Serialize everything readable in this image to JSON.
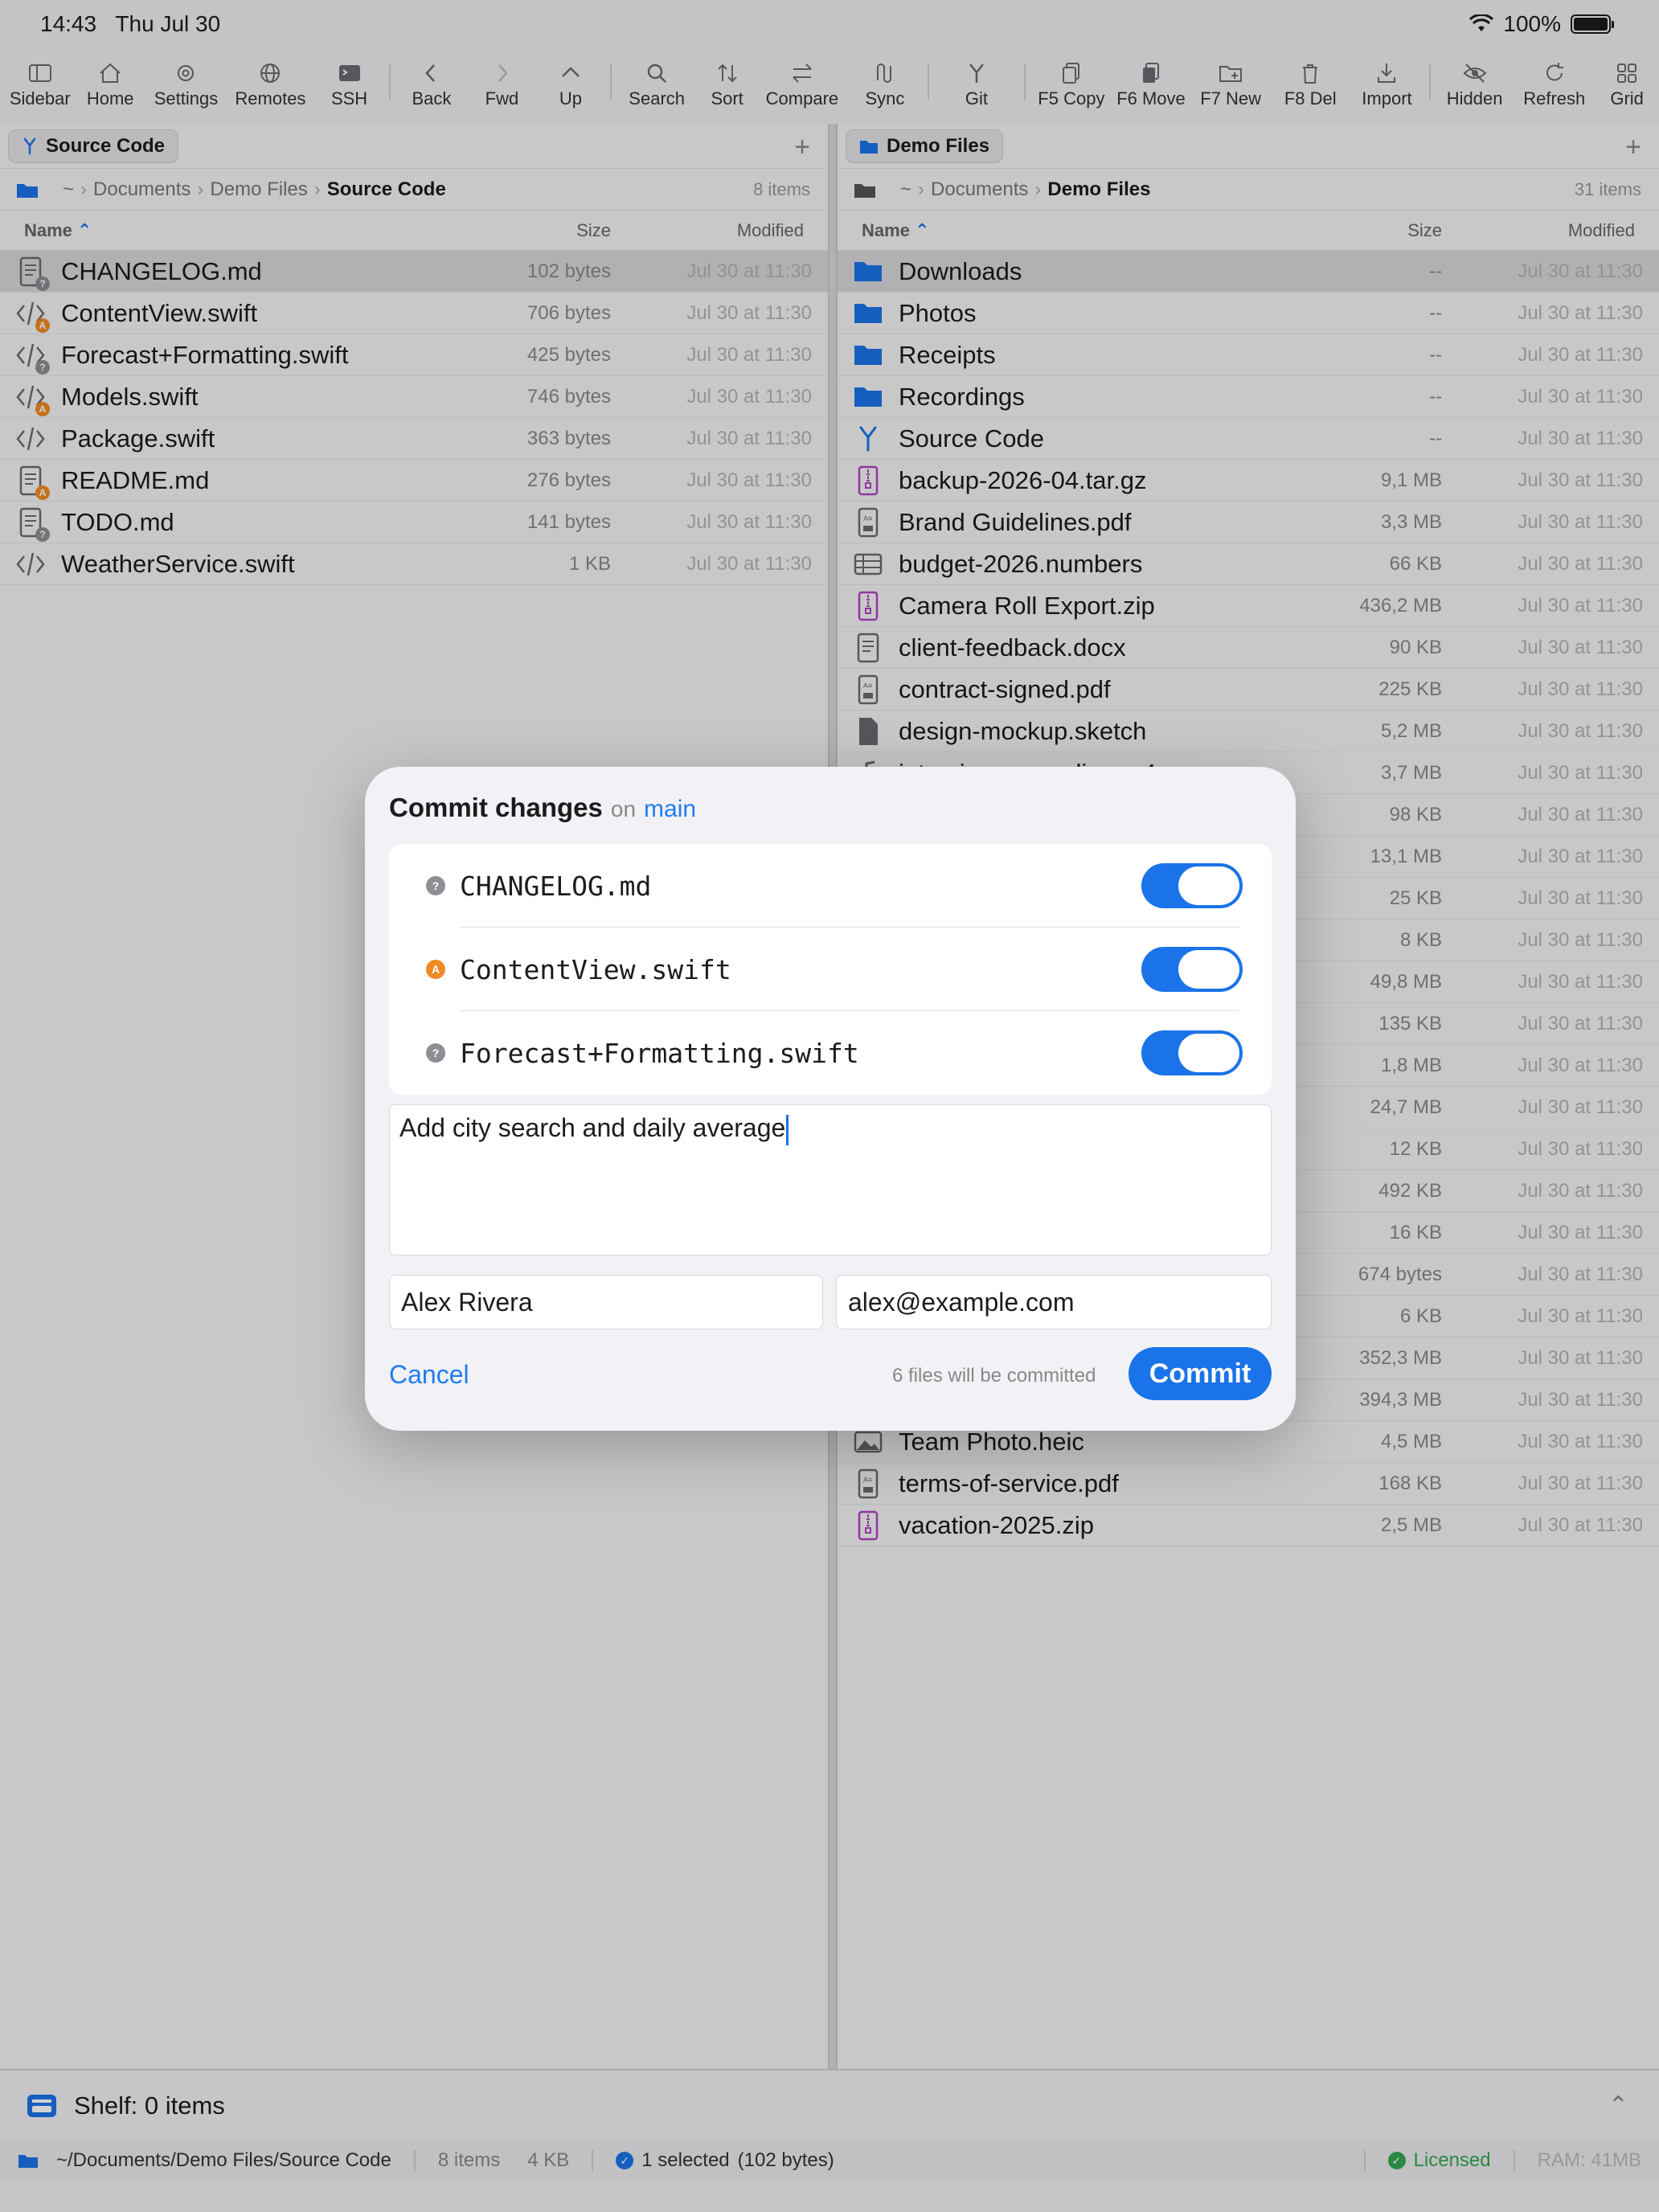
{
  "status": {
    "time": "14:43",
    "date": "Thu Jul 30",
    "battery": "100%"
  },
  "toolbar": [
    {
      "label": "Sidebar",
      "icon": "sidebar-icon"
    },
    {
      "label": "Home",
      "icon": "home-icon"
    },
    {
      "label": "Settings",
      "icon": "gear-icon"
    },
    {
      "label": "Remotes",
      "icon": "globe-icon"
    },
    {
      "label": "SSH",
      "icon": "terminal-icon"
    },
    {
      "label": "Back",
      "icon": "chevron-left-icon"
    },
    {
      "label": "Fwd",
      "icon": "chevron-right-icon"
    },
    {
      "label": "Up",
      "icon": "chevron-up-icon"
    },
    {
      "label": "Search",
      "icon": "search-icon"
    },
    {
      "label": "Sort",
      "icon": "sort-icon"
    },
    {
      "label": "Compare",
      "icon": "compare-icon"
    },
    {
      "label": "Sync",
      "icon": "sync-icon"
    },
    {
      "label": "Git",
      "icon": "git-branch-icon"
    },
    {
      "label": "F5 Copy",
      "icon": "copy-icon"
    },
    {
      "label": "F6 Move",
      "icon": "move-icon"
    },
    {
      "label": "F7 New",
      "icon": "new-folder-icon"
    },
    {
      "label": "F8 Del",
      "icon": "trash-icon"
    },
    {
      "label": "Import",
      "icon": "import-icon"
    },
    {
      "label": "Hidden",
      "icon": "eye-slash-icon"
    },
    {
      "label": "Refresh",
      "icon": "refresh-icon"
    },
    {
      "label": "Grid",
      "icon": "grid-icon"
    }
  ],
  "left": {
    "tab": "Source Code",
    "breadcrumb": [
      "~",
      "Documents",
      "Demo Files"
    ],
    "current": "Source Code",
    "count": "8 items",
    "headers": {
      "name": "Name",
      "size": "Size",
      "modified": "Modified"
    },
    "files": [
      {
        "name": "CHANGELOG.md",
        "size": "102 bytes",
        "modified": "Jul 30 at 11:30",
        "kind": "doc",
        "badge": "q"
      },
      {
        "name": "ContentView.swift",
        "size": "706 bytes",
        "modified": "Jul 30 at 11:30",
        "kind": "code",
        "badge": "a"
      },
      {
        "name": "Forecast+Formatting.swift",
        "size": "425 bytes",
        "modified": "Jul 30 at 11:30",
        "kind": "code",
        "badge": "q"
      },
      {
        "name": "Models.swift",
        "size": "746 bytes",
        "modified": "Jul 30 at 11:30",
        "kind": "code",
        "badge": "a"
      },
      {
        "name": "Package.swift",
        "size": "363 bytes",
        "modified": "Jul 30 at 11:30",
        "kind": "code",
        "badge": ""
      },
      {
        "name": "README.md",
        "size": "276 bytes",
        "modified": "Jul 30 at 11:30",
        "kind": "doc",
        "badge": "a"
      },
      {
        "name": "TODO.md",
        "size": "141 bytes",
        "modified": "Jul 30 at 11:30",
        "kind": "doc",
        "badge": "q"
      },
      {
        "name": "WeatherService.swift",
        "size": "1 KB",
        "modified": "Jul 30 at 11:30",
        "kind": "code",
        "badge": ""
      }
    ]
  },
  "right": {
    "tab": "Demo Files",
    "breadcrumb": [
      "~",
      "Documents"
    ],
    "current": "Demo Files",
    "count": "31 items",
    "headers": {
      "name": "Name",
      "size": "Size",
      "modified": "Modified"
    },
    "files": [
      {
        "name": "Downloads",
        "size": "--",
        "modified": "Jul 30 at 11:30",
        "kind": "folder"
      },
      {
        "name": "Photos",
        "size": "--",
        "modified": "Jul 30 at 11:30",
        "kind": "folder"
      },
      {
        "name": "Receipts",
        "size": "--",
        "modified": "Jul 30 at 11:30",
        "kind": "folder"
      },
      {
        "name": "Recordings",
        "size": "--",
        "modified": "Jul 30 at 11:30",
        "kind": "folder"
      },
      {
        "name": "Source Code",
        "size": "--",
        "modified": "Jul 30 at 11:30",
        "kind": "git"
      },
      {
        "name": "backup-2026-04.tar.gz",
        "size": "9,1 MB",
        "modified": "Jul 30 at 11:30",
        "kind": "zip"
      },
      {
        "name": "Brand Guidelines.pdf",
        "size": "3,3 MB",
        "modified": "Jul 30 at 11:30",
        "kind": "pdf"
      },
      {
        "name": "budget-2026.numbers",
        "size": "66 KB",
        "modified": "Jul 30 at 11:30",
        "kind": "table"
      },
      {
        "name": "Camera Roll Export.zip",
        "size": "436,2 MB",
        "modified": "Jul 30 at 11:30",
        "kind": "zip"
      },
      {
        "name": "client-feedback.docx",
        "size": "90 KB",
        "modified": "Jul 30 at 11:30",
        "kind": "doc"
      },
      {
        "name": "contract-signed.pdf",
        "size": "225 KB",
        "modified": "Jul 30 at 11:30",
        "kind": "pdf"
      },
      {
        "name": "design-mockup.sketch",
        "size": "5,2 MB",
        "modified": "Jul 30 at 11:30",
        "kind": "file"
      },
      {
        "name": "interview_recording.m4a",
        "size": "3,7 MB",
        "modified": "Jul 30 at 11:30",
        "kind": "audio"
      },
      {
        "name": "",
        "size": "98 KB",
        "modified": "Jul 30 at 11:30",
        "kind": "file"
      },
      {
        "name": "",
        "size": "13,1 MB",
        "modified": "Jul 30 at 11:30",
        "kind": "file"
      },
      {
        "name": "",
        "size": "25 KB",
        "modified": "Jul 30 at 11:30",
        "kind": "file"
      },
      {
        "name": "",
        "size": "8 KB",
        "modified": "Jul 30 at 11:30",
        "kind": "file"
      },
      {
        "name": "",
        "size": "49,8 MB",
        "modified": "Jul 30 at 11:30",
        "kind": "file"
      },
      {
        "name": "",
        "size": "135 KB",
        "modified": "Jul 30 at 11:30",
        "kind": "file"
      },
      {
        "name": "",
        "size": "1,8 MB",
        "modified": "Jul 30 at 11:30",
        "kind": "file"
      },
      {
        "name": "",
        "size": "24,7 MB",
        "modified": "Jul 30 at 11:30",
        "kind": "file"
      },
      {
        "name": "",
        "size": "12 KB",
        "modified": "Jul 30 at 11:30",
        "kind": "file"
      },
      {
        "name": "",
        "size": "492 KB",
        "modified": "Jul 30 at 11:30",
        "kind": "file"
      },
      {
        "name": "",
        "size": "16 KB",
        "modified": "Jul 30 at 11:30",
        "kind": "file"
      },
      {
        "name": "",
        "size": "674 bytes",
        "modified": "Jul 30 at 11:30",
        "kind": "file"
      },
      {
        "name": "",
        "size": "6 KB",
        "modified": "Jul 30 at 11:30",
        "kind": "file"
      },
      {
        "name": "",
        "size": "352,3 MB",
        "modified": "Jul 30 at 11:30",
        "kind": "file"
      },
      {
        "name": "",
        "size": "394,3 MB",
        "modified": "Jul 30 at 11:30",
        "kind": "file"
      },
      {
        "name": "Team Photo.heic",
        "size": "4,5 MB",
        "modified": "Jul 30 at 11:30",
        "kind": "image"
      },
      {
        "name": "terms-of-service.pdf",
        "size": "168 KB",
        "modified": "Jul 30 at 11:30",
        "kind": "pdf"
      },
      {
        "name": "vacation-2025.zip",
        "size": "2,5 MB",
        "modified": "Jul 30 at 11:30",
        "kind": "zip"
      }
    ]
  },
  "modal": {
    "title": "Commit changes",
    "on": "on",
    "branch": "main",
    "files": [
      {
        "name": "CHANGELOG.md",
        "badge": "q",
        "enabled": true
      },
      {
        "name": "ContentView.swift",
        "badge": "a",
        "enabled": true
      },
      {
        "name": "Forecast+Formatting.swift",
        "badge": "q",
        "enabled": true
      }
    ],
    "message": "Add city search and daily average",
    "author": "Alex Rivera",
    "email": "alex@example.com",
    "cancel": "Cancel",
    "hint": "6 files will be committed",
    "commit": "Commit"
  },
  "shelf": {
    "label": "Shelf: 0 items"
  },
  "bottom": {
    "path": "~/Documents/Demo Files/Source Code",
    "items": "8 items",
    "size": "4 KB",
    "selected": "1 selected",
    "selected_detail": "(102 bytes)",
    "license": "Licensed",
    "ram": "RAM: 41MB"
  },
  "colors": {
    "accent": "#1a73e8",
    "folder": "#1a73e8",
    "zip": "#b044c4",
    "badge_add": "#f08a24",
    "badge_unknown": "#8e8e93",
    "licensed": "#34a853"
  }
}
